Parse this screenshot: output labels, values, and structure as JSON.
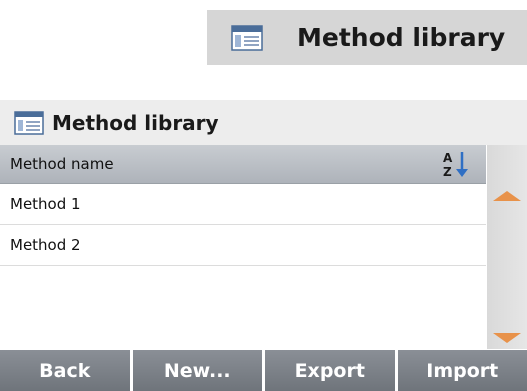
{
  "banner": {
    "title": "Method library",
    "icon": "method-library-icon"
  },
  "header": {
    "title": "Method library",
    "icon": "method-library-icon"
  },
  "list": {
    "column_header": "Method name",
    "sort_icon": "sort-az-icon",
    "rows": [
      {
        "label": "Method 1"
      },
      {
        "label": "Method 2"
      }
    ]
  },
  "scrollbar": {
    "up_icon": "scroll-up-arrow-icon",
    "down_icon": "scroll-down-arrow-icon",
    "arrow_color": "#e8924a"
  },
  "footer": {
    "back_label": "Back",
    "new_label": "New...",
    "export_label": "Export",
    "import_label": "Import"
  }
}
